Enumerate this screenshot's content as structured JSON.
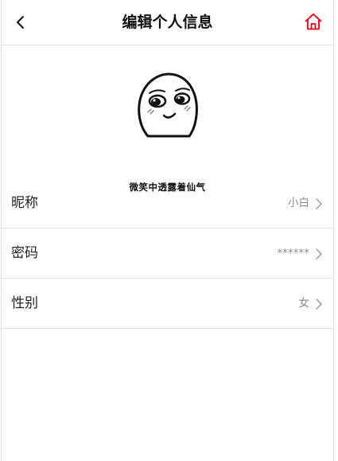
{
  "header": {
    "title": "编辑个人信息",
    "back_icon": "chevron-left-icon",
    "home_icon": "home-icon",
    "home_icon_color": "#e60012"
  },
  "avatar": {
    "caption": "微笑中透露着仙气"
  },
  "fields": [
    {
      "label": "昵称",
      "value": "小白"
    },
    {
      "label": "密码",
      "value": "******"
    },
    {
      "label": "性别",
      "value": "女"
    }
  ]
}
